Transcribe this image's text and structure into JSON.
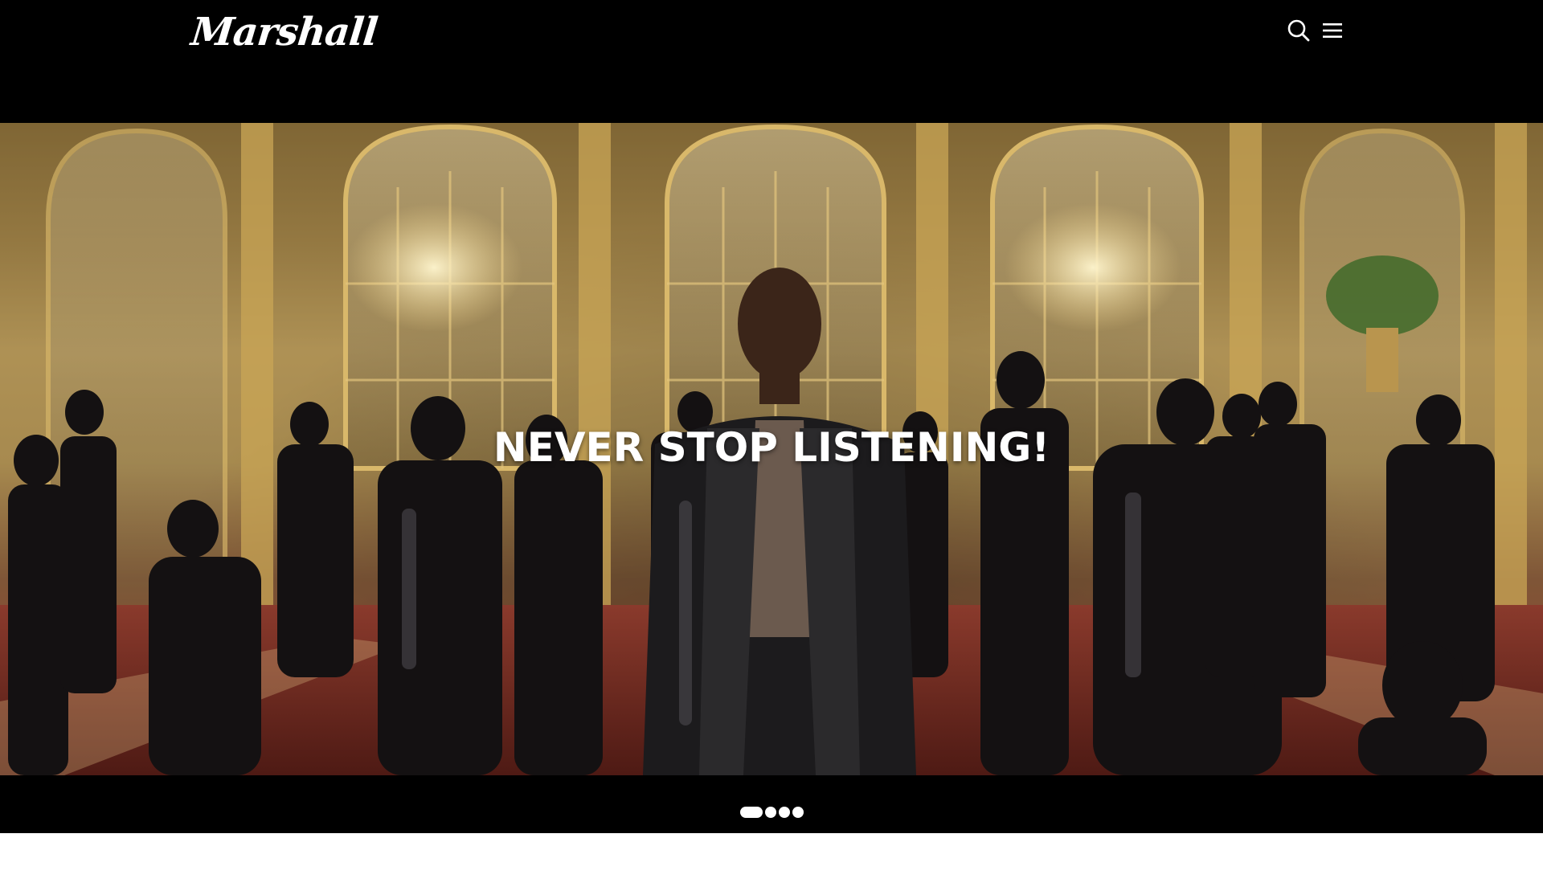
{
  "header": {
    "logo_text": "Marshall",
    "search_icon": "search-icon",
    "menu_icon": "hamburger-menu-icon"
  },
  "hero": {
    "title": "NEVER STOP LISTENING!",
    "image_icon": "hero-photo"
  },
  "carousel": {
    "slide_count": 4,
    "active_index": 0
  },
  "colors": {
    "header_bg": "#000000",
    "text": "#ffffff",
    "page_bg": "#ffffff"
  }
}
